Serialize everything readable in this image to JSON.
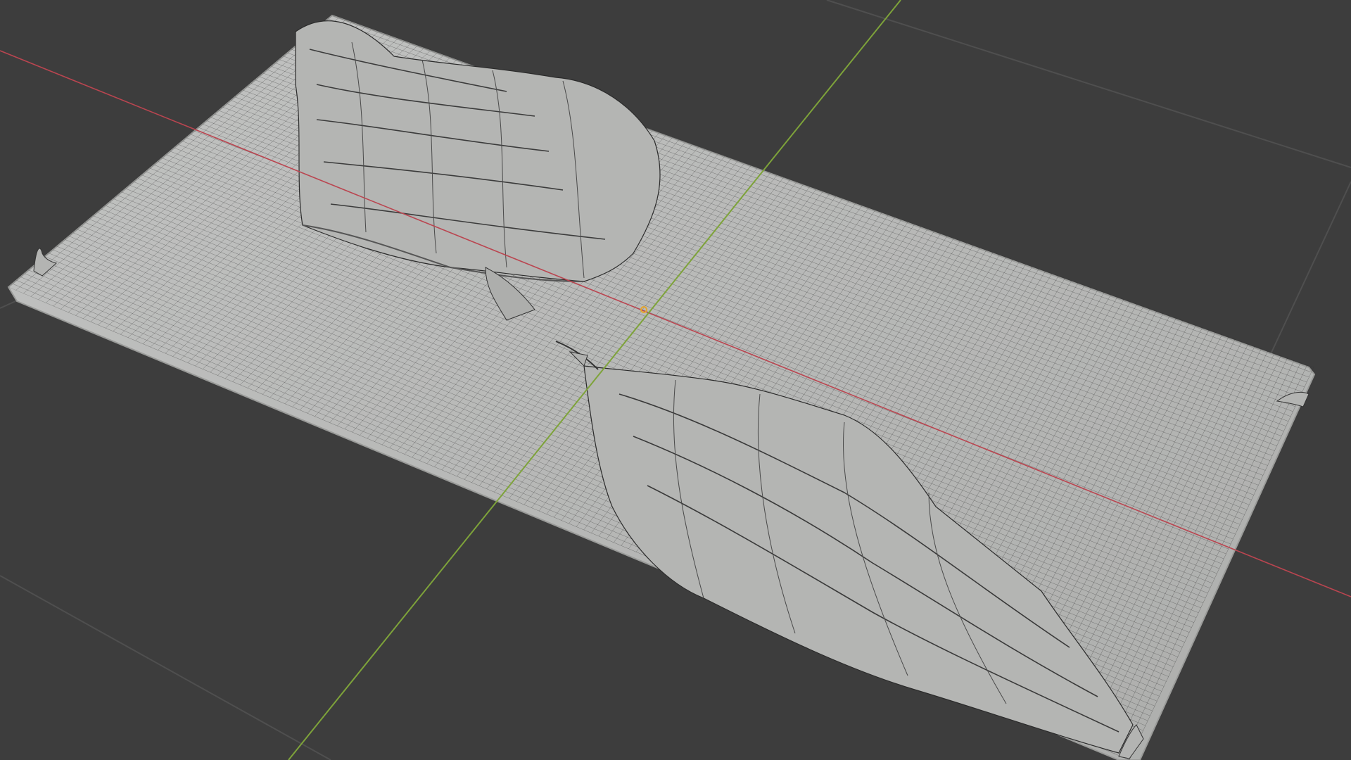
{
  "viewport": {
    "mode": "3d-viewport",
    "shading": "solid",
    "overlays": {
      "wireframe": true,
      "floor_grid": true,
      "x_axis": true,
      "y_axis": true,
      "origin_marker": true
    }
  },
  "object": {
    "kind": "terrain-mesh",
    "features": [
      "plateau-ridge-left",
      "ridge-right",
      "raised-edge-left",
      "raised-edge-right"
    ]
  },
  "colors": {
    "background": "#3d3d3d",
    "floor_grid": "#4f4f4f",
    "x_axis": "#ba4550",
    "y_axis": "#7ea33a",
    "mesh_fill": "#b9bab9",
    "mesh_wire": "#2f2f2f",
    "origin": "#e6a52a"
  }
}
